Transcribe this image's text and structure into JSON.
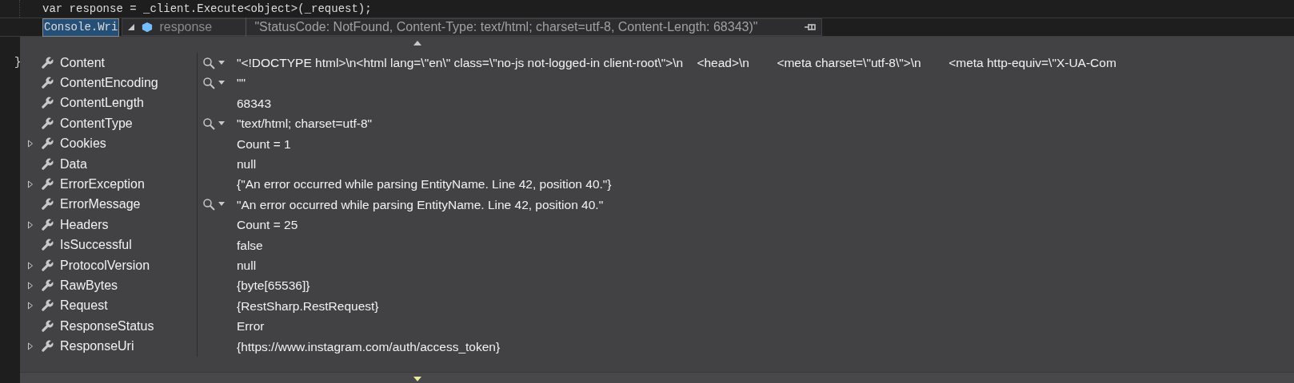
{
  "editor": {
    "lines": [
      {
        "kind": "code",
        "text": "var response = _client.Execute<object>(_request);"
      },
      {
        "kind": "partial",
        "text": "Console.Wri"
      },
      {
        "kind": "brace",
        "text": "}"
      }
    ]
  },
  "datatip": {
    "expanded": true,
    "name": "response",
    "value": "\"StatusCode: NotFound, Content-Type: text/html; charset=utf-8, Content-Length: 68343)\"",
    "rows": [
      {
        "name": "Content",
        "expandable": false,
        "viewer": true,
        "value": "\"<!DOCTYPE html>\\n<html lang=\\\"en\\\" class=\\\"no-js not-logged-in client-root\\\">\\n    <head>\\n        <meta charset=\\\"utf-8\\\">\\n        <meta http-equiv=\\\"X-UA-Com"
      },
      {
        "name": "ContentEncoding",
        "expandable": false,
        "viewer": true,
        "value": "\"\""
      },
      {
        "name": "ContentLength",
        "expandable": false,
        "viewer": false,
        "value": "68343"
      },
      {
        "name": "ContentType",
        "expandable": false,
        "viewer": true,
        "value": "\"text/html; charset=utf-8\""
      },
      {
        "name": "Cookies",
        "expandable": true,
        "viewer": false,
        "value": "Count = 1"
      },
      {
        "name": "Data",
        "expandable": false,
        "viewer": false,
        "value": "null"
      },
      {
        "name": "ErrorException",
        "expandable": true,
        "viewer": false,
        "value": "{\"An error occurred while parsing EntityName. Line 42, position 40.\"}"
      },
      {
        "name": "ErrorMessage",
        "expandable": false,
        "viewer": true,
        "value": "\"An error occurred while parsing EntityName. Line 42, position 40.\""
      },
      {
        "name": "Headers",
        "expandable": true,
        "viewer": false,
        "value": "Count = 25"
      },
      {
        "name": "IsSuccessful",
        "expandable": false,
        "viewer": false,
        "value": "false"
      },
      {
        "name": "ProtocolVersion",
        "expandable": true,
        "viewer": false,
        "value": "null"
      },
      {
        "name": "RawBytes",
        "expandable": true,
        "viewer": false,
        "value": "{byte[65536]}"
      },
      {
        "name": "Request",
        "expandable": true,
        "viewer": false,
        "value": "{RestSharp.RestRequest}"
      },
      {
        "name": "ResponseStatus",
        "expandable": false,
        "viewer": false,
        "value": "Error"
      },
      {
        "name": "ResponseUri",
        "expandable": true,
        "viewer": false,
        "value": "{https://www.instagram.com/auth/access_token}"
      }
    ]
  }
}
